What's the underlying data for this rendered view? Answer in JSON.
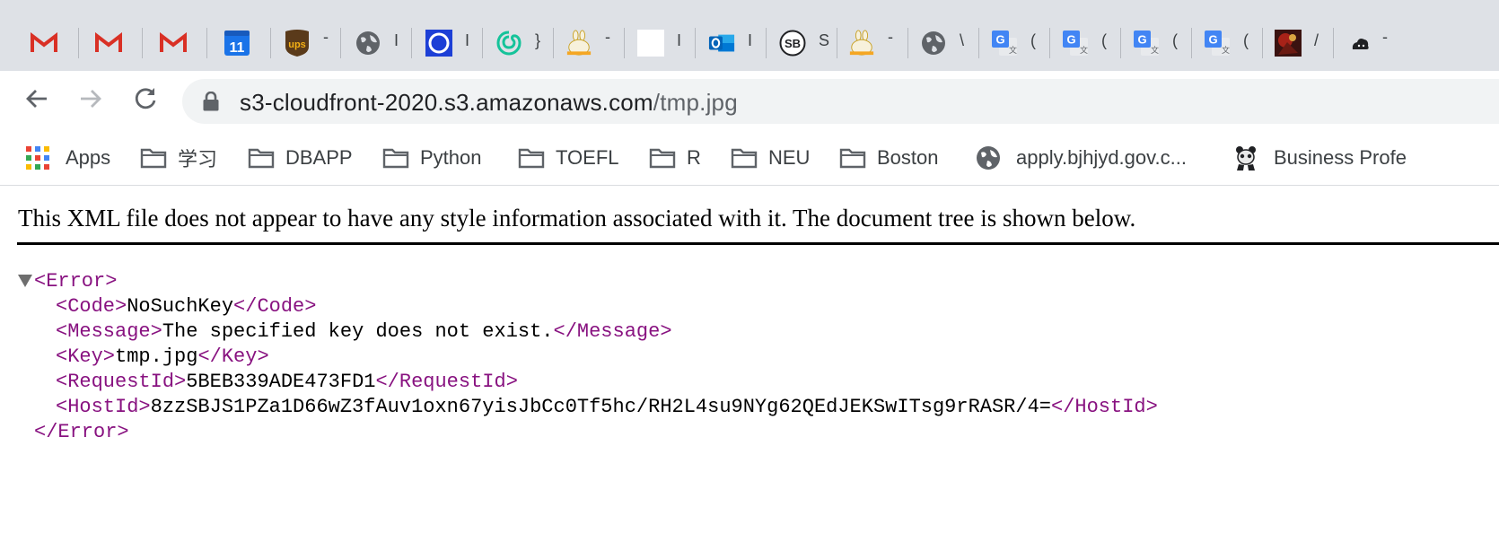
{
  "tabs": [
    {
      "icon": "gmail-icon",
      "char": ""
    },
    {
      "icon": "gmail-icon",
      "char": ""
    },
    {
      "icon": "gmail-icon",
      "char": ""
    },
    {
      "icon": "google-calendar-icon",
      "char": "",
      "calendar_day": "11"
    },
    {
      "icon": "ups-icon",
      "char": "-",
      "logo_text": "ups"
    },
    {
      "icon": "globe-icon",
      "char": "I"
    },
    {
      "icon": "blue-swirl-icon",
      "char": "I"
    },
    {
      "icon": "grammarly-icon",
      "char": "}"
    },
    {
      "icon": "bunny-icon",
      "char": "-"
    },
    {
      "icon": "blank-page-icon",
      "char": "I"
    },
    {
      "icon": "outlook-icon",
      "char": "I"
    },
    {
      "icon": "sb-icon",
      "char": "S",
      "logo_text": "SB"
    },
    {
      "icon": "bunny-icon",
      "char": "-"
    },
    {
      "icon": "globe-icon",
      "char": "\\"
    },
    {
      "icon": "google-translate-icon",
      "char": "("
    },
    {
      "icon": "google-translate-icon",
      "char": "("
    },
    {
      "icon": "google-translate-icon",
      "char": "("
    },
    {
      "icon": "google-translate-icon",
      "char": "("
    },
    {
      "icon": "game-art-icon",
      "char": "/"
    },
    {
      "icon": "cloud-icon",
      "char": "-"
    }
  ],
  "toolbar": {
    "url_host": "s3-cloudfront-2020.s3.amazonaws.com",
    "url_path": "/tmp.jpg"
  },
  "bookmarks": [
    {
      "icon": "apps-grid-icon",
      "label": "Apps"
    },
    {
      "icon": "folder-icon",
      "label": "学习"
    },
    {
      "icon": "folder-icon",
      "label": "DBAPP"
    },
    {
      "icon": "folder-icon",
      "label": "Python"
    },
    {
      "icon": "folder-icon",
      "label": "TOEFL"
    },
    {
      "icon": "folder-icon",
      "label": "R"
    },
    {
      "icon": "folder-icon",
      "label": "NEU"
    },
    {
      "icon": "folder-icon",
      "label": "Boston"
    },
    {
      "icon": "globe-icon",
      "label": "apply.bjhjyd.gov.c..."
    },
    {
      "icon": "panda-icon",
      "label": "Business Profe"
    }
  ],
  "content": {
    "notice": "This XML file does not appear to have any style information associated with it. The document tree is shown below.",
    "xml": {
      "root_open": "<Error>",
      "root_close": "</Error>",
      "code": {
        "open": "<Code>",
        "value": "NoSuchKey",
        "close": "</Code>"
      },
      "message": {
        "open": "<Message>",
        "value": "The specified key does not exist.",
        "close": "</Message>"
      },
      "key": {
        "open": "<Key>",
        "value": "tmp.jpg",
        "close": "</Key>"
      },
      "request_id": {
        "open": "<RequestId>",
        "value": "5BEB339ADE473FD1",
        "close": "</RequestId>"
      },
      "host_id": {
        "open": "<HostId>",
        "value": "8zzSBJS1PZa1D66wZ3fAuv1oxn67yisJbCc0Tf5hc/RH2L4su9NYg62QEdJEKSwITsg9rRASR/4=",
        "close": "</HostId>"
      }
    }
  },
  "colors": {
    "tabstrip_bg": "#dee1e6",
    "omnibox_bg": "#f1f3f4",
    "xml_tag": "#881280",
    "url_path": "#5f6368"
  }
}
